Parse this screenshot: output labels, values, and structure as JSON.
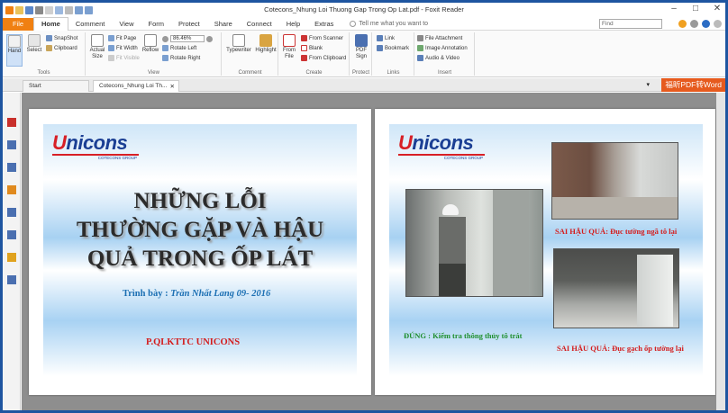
{
  "window": {
    "title": "Cotecons_Nhung Loi Thuong Gap Trong Op Lat.pdf - Foxit Reader",
    "find_placeholder": "Find"
  },
  "menu": {
    "file": "File",
    "items": [
      "Home",
      "Comment",
      "View",
      "Form",
      "Protect",
      "Share",
      "Connect",
      "Help",
      "Extras"
    ],
    "tell_me": "Tell me what you want to"
  },
  "ribbon": {
    "tools": {
      "label": "Tools",
      "hand": "Hand",
      "select": "Select",
      "snapshot": "SnapShot",
      "clipboard": "Clipboard"
    },
    "view": {
      "label": "View",
      "actual_size": "Actual Size",
      "fit_page": "Fit Page",
      "fit_width": "Fit Width",
      "fit_visible": "Fit Visible",
      "reflow": "Reflow",
      "zoom": "86.46%",
      "rotate_left": "Rotate Left",
      "rotate_right": "Rotate Right"
    },
    "comment": {
      "label": "Comment",
      "typewriter": "Typewriter",
      "highlight": "Highlight"
    },
    "create": {
      "label": "Create",
      "from_file": "From File",
      "from_scanner": "From Scanner",
      "blank": "Blank",
      "from_clipboard": "From Clipboard"
    },
    "protect": {
      "label": "Protect",
      "pdf_sign": "PDF Sign"
    },
    "links": {
      "label": "Links",
      "link": "Link",
      "bookmark": "Bookmark"
    },
    "insert": {
      "label": "Insert",
      "file_attachment": "File Attachment",
      "image_annotation": "Image Annotation",
      "audio_video": "Audio & Video"
    }
  },
  "tabs": {
    "start": "Start",
    "doc": "Cotecons_Nhung Loi Th...",
    "promo": "福昕PDF转Word"
  },
  "slide1": {
    "logo_word": "nicons",
    "logo_u": "U",
    "logo_sub": "COTECONS GROUP",
    "headline_1": "NHỮNG LỖI",
    "headline_2": "THƯỜNG GẶP VÀ HẬU",
    "headline_3": "QUẢ TRONG  ỐP LÁT",
    "presenter_label": "Trình bày : ",
    "presenter_name": "Trần Nhất Lang  09- 2016",
    "department": "P.QLKTTC UNICONS"
  },
  "slide2": {
    "logo_word": "nicons",
    "logo_u": "U",
    "logo_sub": "COTECONS GROUP",
    "caption_correct": "ĐÚNG : Kiểm tra thông thủy tô trát",
    "caption_wrong_1": "SAI HẬU QUẢ: Đục tường ngã tô lại",
    "caption_wrong_2": "SAI HẬU QUẢ: Đục gạch ốp tường lại"
  }
}
